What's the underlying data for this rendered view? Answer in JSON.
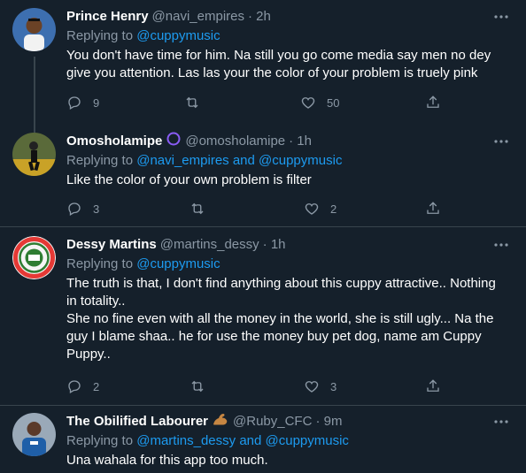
{
  "tweets": [
    {
      "name": "Prince Henry",
      "handle": "@navi_empires",
      "time": "· 2h",
      "replying_prefix": "Replying to ",
      "replying_to": "@cuppymusic",
      "text": "You don't have time for him. Na still you go come media say men no dey\ngive you attention. Las las your the color of your problem is truely pink",
      "replies": "9",
      "retweets": "",
      "likes": "50",
      "more_icon": "more-dots-icon",
      "avatar_color": "#2b6cb0"
    },
    {
      "name": "Omosholamipe",
      "badge_icon": "purple-circle-icon",
      "handle": "@omosholamipe",
      "time": "· 1h",
      "replying_prefix": "Replying to ",
      "replying_to": "@navi_empires and @cuppymusic",
      "text": "Like the color of your own problem is filter",
      "replies": "3",
      "retweets": "",
      "likes": "2",
      "more_icon": "more-dots-icon",
      "avatar_color": "#c9a227"
    },
    {
      "name": "Dessy Martins",
      "handle": "@martins_dessy",
      "time": "· 1h",
      "replying_prefix": "Replying to ",
      "replying_to": "@cuppymusic",
      "text": "The truth is that, I don't find anything about this cuppy attractive.. Nothing\nin totality..\nShe no fine even with all the money in the world, she is still ugly... Na the\nguy I blame shaa.. he for use the money buy pet dog, name am Cuppy\nPuppy..",
      "replies": "2",
      "retweets": "",
      "likes": "3",
      "more_icon": "more-dots-icon",
      "avatar_color": "#e53935"
    },
    {
      "name": "The Obilified Labourer",
      "badge_icon": "flexed-bicep-icon",
      "handle": "@Ruby_CFC",
      "time": "· 9m",
      "replying_prefix": "Replying to ",
      "replying_to": "@martins_dessy and @cuppymusic",
      "text": "Una wahala for this app too much.",
      "more_icon": "more-dots-icon",
      "avatar_color": "#3a6fa8"
    }
  ],
  "colors": {
    "background": "#15202b",
    "link": "#1d9bf0",
    "secondary_text": "#8b98a5",
    "divider": "#38444d"
  }
}
